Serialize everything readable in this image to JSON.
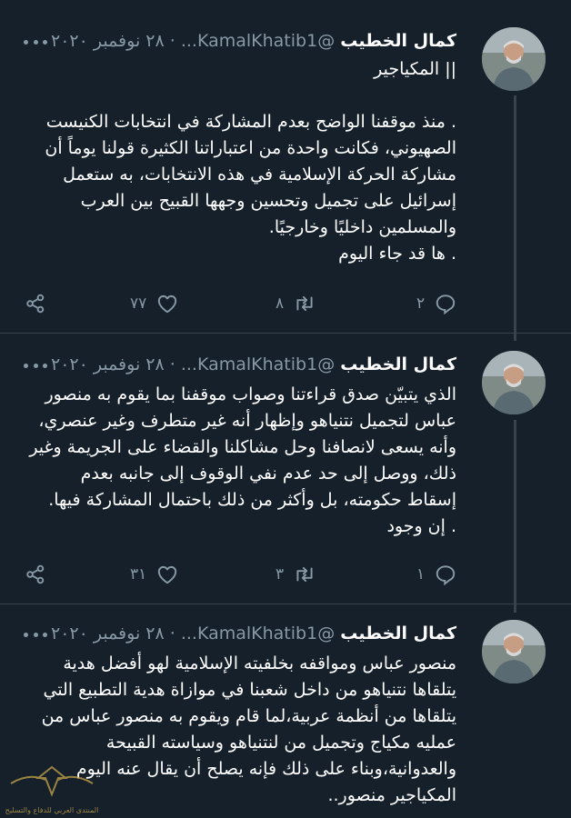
{
  "tweets": [
    {
      "name": "كمال الخطيب",
      "handle": "@KamalKhatib1...",
      "dot": "·",
      "date": "٢٨ نوفمبر ٢٠٢٠",
      "text": "|| المكياجير\n\n. منذ موقفنا الواضح بعدم المشاركة في انتخابات الكنيست الصهيوني، فكانت واحدة من اعتباراتنا الكثيرة قولنا يوماً أن مشاركة الحركة الإسلامية في هذه الانتخابات، به ستعمل إسرائيل على تجميل وتحسين وجهها القبيح بين العرب والمسلمين داخليًا وخارجيًا.\n. ها قد جاء اليوم",
      "reply_count": "٢",
      "retweet_count": "٨",
      "like_count": "٧٧"
    },
    {
      "name": "كمال الخطيب",
      "handle": "@KamalKhatib1...",
      "dot": "·",
      "date": "٢٨ نوفمبر ٢٠٢٠",
      "text": "الذي يتبيّن صدق قراءتنا وصواب موقفنا بما يقوم به منصور عباس لتجميل نتنياهو وإظهار أنه غير متطرف وغير عنصري، وأنه يسعى لانصافنا وحل مشاكلنا والقضاء على الجريمة وغير ذلك، ووصل إلى حد عدم نفي الوقوف إلى جانبه بعدم إسقاط حكومته، بل وأكثر من ذلك باحتمال المشاركة فيها.\n. إن وجود",
      "reply_count": "١",
      "retweet_count": "٣",
      "like_count": "٣١"
    },
    {
      "name": "كمال الخطيب",
      "handle": "@KamalKhatib1...",
      "dot": "·",
      "date": "٢٨ نوفمبر ٢٠٢٠",
      "text": "منصور عباس ومواقفه بخلفيته الإسلامية لهو أفضل هدية يتلقاها نتنياهو من داخل شعبنا في موازاة هدية التطبيع التي يتلقاها من أنظمة عربية،لما قام ويقوم به منصور عباس من عمليه مكياج وتجميل من لنتنياهو وسياسته القبيحة والعدوانية،وبناء على ذلك فإنه يصلح أن يقال عنه اليوم المكياجير منصور..",
      "reply_count": "",
      "retweet_count": "",
      "like_count": ""
    }
  ],
  "watermark": "المنتدى العربي للدفاع والتسليح",
  "icons": {
    "more": "more-dots-icon",
    "reply": "reply-icon",
    "retweet": "retweet-icon",
    "like": "heart-icon",
    "share": "share-icon"
  },
  "colors": {
    "background": "#15202b",
    "secondary_text": "#8899a6",
    "divider": "#38444d"
  }
}
